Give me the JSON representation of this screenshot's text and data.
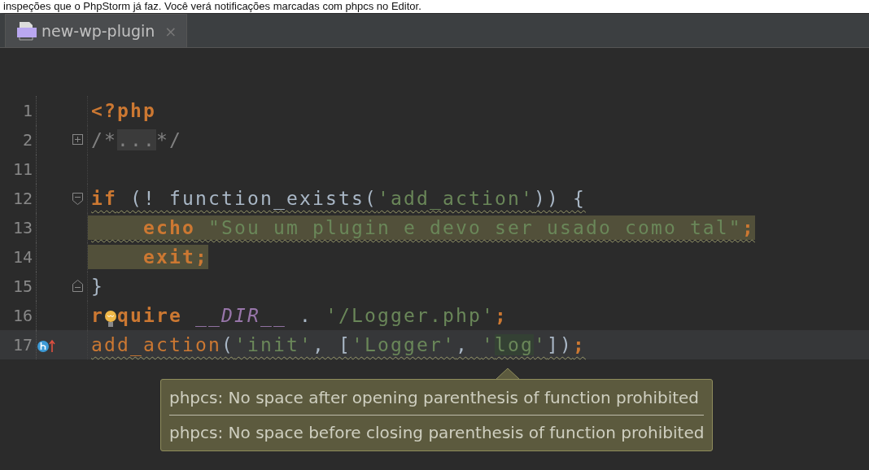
{
  "caption": "inspeções que o PhpStorm já faz. Você verá notificações marcadas com phpcs no Editor.",
  "tabs": [
    {
      "label": "new-wp-plugin",
      "selected": true,
      "close": "×"
    }
  ],
  "lines": [
    {
      "number": "1",
      "highlighted": false,
      "squiggly": false,
      "current": false,
      "tokens": [
        {
          "text": "<?php",
          "kind": "keyword"
        }
      ]
    },
    {
      "number": "2",
      "gutter_icons": [
        {
          "kind": "fold-expand"
        }
      ],
      "highlighted": false,
      "squiggly": false,
      "current": false,
      "tokens": [
        {
          "text": "/*",
          "kind": "comment"
        },
        {
          "text": "...",
          "kind": "fold"
        },
        {
          "text": "*/",
          "kind": "comment"
        }
      ]
    },
    {
      "number": "11",
      "current": false
    },
    {
      "number": "12",
      "gutter_icons": [
        {
          "kind": "fold-collapse"
        }
      ],
      "highlighted": false,
      "squiggly": true,
      "current": false,
      "tokens": [
        {
          "text": "if",
          "kind": "keyword"
        },
        {
          "text": " (! function_exists(",
          "kind": "plain"
        },
        {
          "text": "'add_action'",
          "kind": "string"
        },
        {
          "text": ")) {",
          "kind": "plain"
        }
      ]
    },
    {
      "number": "13",
      "highlighted": true,
      "squiggly": true,
      "current": false,
      "tokens": [
        {
          "text": "    echo",
          "kind": "keyword"
        },
        {
          "text": " \"Sou um plugin e devo ser usado como tal\"",
          "kind": "string"
        },
        {
          "text": ";",
          "kind": "keyword"
        }
      ]
    },
    {
      "number": "14",
      "highlighted": true,
      "squiggly": false,
      "current": false,
      "tokens": [
        {
          "text": "    exit;",
          "kind": "keyword"
        }
      ]
    },
    {
      "number": "15",
      "gutter_icons": [
        {
          "kind": "fold-end"
        }
      ],
      "highlighted": false,
      "squiggly": false,
      "current": false,
      "tokens": [
        {
          "text": "}",
          "kind": "plain"
        }
      ]
    },
    {
      "number": "16",
      "highlighted": false,
      "squiggly": false,
      "current": false,
      "tokens": [
        {
          "text": "r",
          "kind": "keyword"
        },
        {
          "kind": "bulb"
        },
        {
          "text": "quire",
          "kind": "keyword"
        },
        {
          "text": " __DIR__",
          "kind": "constant"
        },
        {
          "text": " . ",
          "kind": "plain"
        },
        {
          "text": "'/Logger.php'",
          "kind": "string"
        },
        {
          "text": ";",
          "kind": "keyword"
        }
      ]
    },
    {
      "number": "17",
      "gutter_icons": [
        {
          "kind": "implements"
        }
      ],
      "highlighted": false,
      "squiggly": true,
      "current": true,
      "tokens": [
        {
          "text": "add_action",
          "kind": "call"
        },
        {
          "text": "(",
          "kind": "plain"
        },
        {
          "text": "'init'",
          "kind": "string"
        },
        {
          "text": ", [",
          "kind": "plain"
        },
        {
          "text": "'Logger'",
          "kind": "string"
        },
        {
          "text": ", ",
          "kind": "plain"
        },
        {
          "text": "'",
          "kind": "string"
        },
        {
          "text": "log",
          "kind": "string-marked"
        },
        {
          "text": "'",
          "kind": "string"
        },
        {
          "text": "])",
          "kind": "plain"
        },
        {
          "text": ";",
          "kind": "keyword"
        }
      ]
    }
  ],
  "tooltip": {
    "messages": [
      "phpcs: No space after opening parenthesis of function prohibited",
      "phpcs: No space before closing parenthesis of function prohibited"
    ]
  }
}
